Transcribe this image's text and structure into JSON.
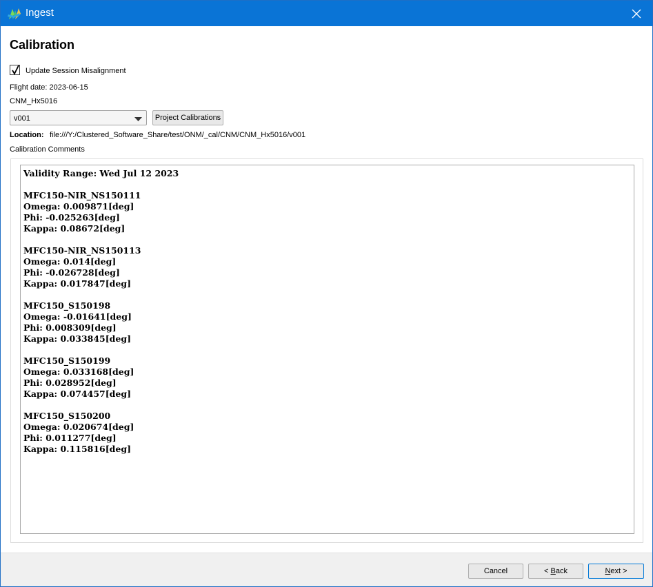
{
  "window": {
    "title": "Ingest",
    "close_icon": "close-icon",
    "app_icon": "ingest-logo-icon"
  },
  "page": {
    "heading": "Calibration",
    "update_misalignment": {
      "label": "Update Session Misalignment",
      "checked": true
    },
    "flight_date": "Flight date: 2023-06-15",
    "sensor_name": "CNM_Hx5016",
    "version_select": {
      "value": "v001"
    },
    "project_calibrations_button": "Project Calibrations",
    "location": {
      "label": "Location:",
      "value": "file:///Y:/Clustered_Software_Share/test/ONM/_cal/CNM/CNM_Hx5016/v001"
    },
    "comments_label": "Calibration Comments",
    "comments_lines": [
      "Validity Range: Wed Jul 12 2023",
      "",
      "MFC150-NIR_NS150111",
      "Omega: 0.009871[deg]",
      "Phi: -0.025263[deg]",
      "Kappa: 0.08672[deg]",
      "",
      "MFC150-NIR_NS150113",
      "Omega: 0.014[deg]",
      "Phi: -0.026728[deg]",
      "Kappa: 0.017847[deg]",
      "",
      "MFC150_S150198",
      "Omega: -0.01641[deg]",
      "Phi: 0.008309[deg]",
      "Kappa: 0.033845[deg]",
      "",
      "MFC150_S150199",
      "Omega: 0.033168[deg]",
      "Phi: 0.028952[deg]",
      "Kappa: 0.074457[deg]",
      "",
      "MFC150_S150200",
      "Omega: 0.020674[deg]",
      "Phi: 0.011277[deg]",
      "Kappa: 0.115816[deg]"
    ]
  },
  "footer": {
    "cancel": "Cancel",
    "back_prefix": "< ",
    "back_mnemonic": "B",
    "back_rest": "ack",
    "next_mnemonic": "N",
    "next_rest": "ext >"
  },
  "colors": {
    "titlebar": "#0a74d6",
    "accent": "#0078d7"
  }
}
